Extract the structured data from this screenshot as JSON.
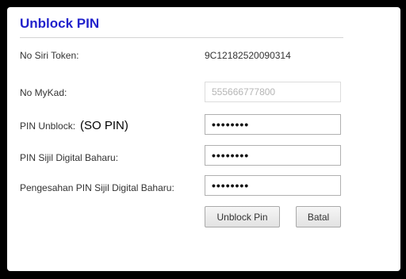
{
  "dialog": {
    "title": "Unblock PIN",
    "rows": {
      "token_label": "No Siri Token:",
      "token_value": "9C12182520090314",
      "mykad_label": "No MyKad:",
      "mykad_value": "555666777800",
      "unblock_label": "PIN Unblock:",
      "unblock_annotation": "(SO PIN)",
      "unblock_value": "••••••••",
      "new_pin_label": "PIN Sijil Digital Baharu:",
      "new_pin_value": "••••••••",
      "confirm_pin_label": "Pengesahan PIN Sijil Digital Baharu:",
      "confirm_pin_value": "••••••••"
    },
    "buttons": {
      "unblock": "Unblock Pin",
      "cancel": "Batal"
    }
  },
  "colors": {
    "title": "#2222cc",
    "backdrop": "#000000"
  }
}
